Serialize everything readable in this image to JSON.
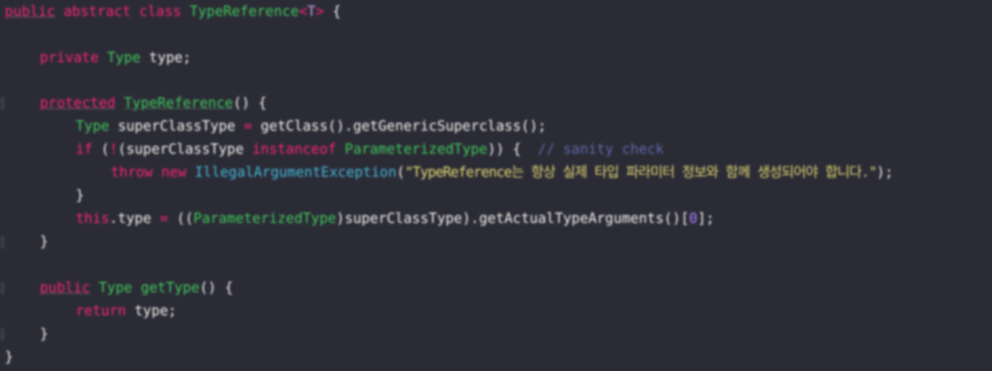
{
  "code": {
    "l1": {
      "public": "public",
      "abstract": "abstract",
      "class": "class",
      "name": "TypeReference",
      "gen_open": "<",
      "gen_param": "T",
      "gen_close": ">",
      "brace": " {"
    },
    "l3": {
      "private": "private",
      "type": "Type",
      "field": " type;"
    },
    "l5": {
      "protected": "protected",
      "ctor": "TypeReference",
      "rest": "() {"
    },
    "l6": {
      "type": "Type",
      "decl": " superClassType ",
      "eq": "=",
      "call": " getClass().getGenericSuperclass();"
    },
    "l7": {
      "if": "if",
      "open": " (",
      "not": "!",
      "var": "(superClassType ",
      "instanceof": "instanceof",
      "ptype": "ParameterizedType",
      "close": ")) {  ",
      "comment": "// sanity check"
    },
    "l8": {
      "throw": "throw",
      "new": "new",
      "exc": "IllegalArgumentException",
      "paren_open": "(",
      "string": "\"TypeReference는 항상 실제 타입 파라미터 정보와 함께 생성되어야 합니다.\"",
      "paren_close": ");"
    },
    "l9": {
      "brace": "}"
    },
    "l10": {
      "this": "this",
      "field": ".type ",
      "eq": "=",
      "cast_open": " ((",
      "ptype": "ParameterizedType",
      "rest": ")superClassType).getActualTypeArguments()[",
      "index": "0",
      "end": "];"
    },
    "l11": {
      "brace": "}"
    },
    "l13": {
      "public": "public",
      "type": "Type",
      "method": "getType",
      "rest": "() {"
    },
    "l14": {
      "return": "return",
      "rest": " type;"
    },
    "l15": {
      "brace": "}"
    },
    "l16": {
      "brace": "}"
    }
  }
}
